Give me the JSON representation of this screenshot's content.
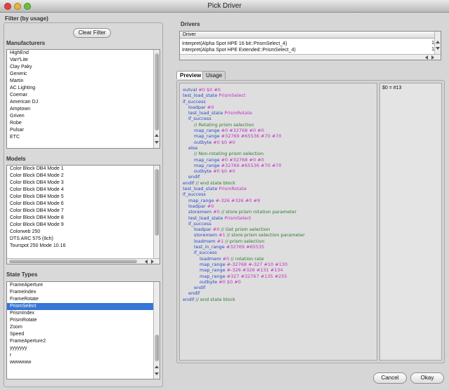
{
  "window": {
    "title": "Pick Driver"
  },
  "filter": {
    "title": "Filter (by usage)",
    "clear_button": "Clear Filter"
  },
  "manufacturers": {
    "label": "Manufacturers",
    "items": [
      "HighEnd",
      "Vari*Lite",
      "Clay Paky",
      "Generic",
      "Martin",
      "AC Lighting",
      "Coemar",
      "American DJ",
      "Amptown",
      "Griven",
      "Robe",
      "Pulsar",
      "ETC"
    ]
  },
  "models": {
    "label": "Models",
    "items": [
      "Color Block DB4 Mode 1",
      "Color Block DB4 Mode 2",
      "Color Block DB4 Mode 3",
      "Color Block DB4 Mode 4",
      "Color Block DB4 Mode 5",
      "Color Block DB4 Mode 6",
      "Color Block DB4 Mode 7",
      "Color Block DB4 Mode 8",
      "Color Block DB4 Mode 9",
      "Colorweb 250",
      "DTS ARC 575 (8ch)",
      "Tourspot 250 Mode 10.16"
    ]
  },
  "state_types": {
    "label": "State Types",
    "selected_index": 3,
    "items": [
      "FrameAperture",
      "FrameIndex",
      "FrameRotate",
      "PrismSelect",
      "PrismIndex",
      "PrismRotate",
      "Zoom",
      "Speed",
      "FrameAperture2",
      "yyyyyyy",
      "r",
      "wwwwww"
    ]
  },
  "drivers": {
    "label": "Drivers",
    "column_header": "Driver",
    "rows": [
      {
        "name": "Interpret(Alpha Spot HPE 16 bit::PrismSelect_4)",
        "flag": "1"
      },
      {
        "name": "Interpret(Alpha Spot HPE Extended::PrismSelect_4)",
        "flag": "1"
      }
    ]
  },
  "tabs": [
    {
      "label": "Preview",
      "active": true
    },
    {
      "label": "Usage",
      "active": false
    }
  ],
  "preview_code": [
    {
      "indent": 0,
      "parts": [
        {
          "t": "outval",
          "c": "kw"
        },
        {
          "t": " #0 $0 #0",
          "c": "arg"
        }
      ]
    },
    {
      "indent": 0,
      "parts": [
        {
          "t": "test_load_state",
          "c": "kw"
        },
        {
          "t": " PrismSelect",
          "c": "arg"
        }
      ]
    },
    {
      "indent": 0,
      "parts": [
        {
          "t": "if_success",
          "c": "kw"
        }
      ]
    },
    {
      "indent": 1,
      "parts": [
        {
          "t": "loadpar",
          "c": "kw"
        },
        {
          "t": " #0",
          "c": "arg"
        }
      ]
    },
    {
      "indent": 1,
      "parts": [
        {
          "t": "test_load_state",
          "c": "kw"
        },
        {
          "t": " PrismRotate",
          "c": "arg"
        }
      ]
    },
    {
      "indent": 1,
      "parts": [
        {
          "t": "if_success",
          "c": "kw"
        }
      ]
    },
    {
      "indent": 2,
      "parts": [
        {
          "t": "// Rotating prism selection",
          "c": "cm"
        }
      ]
    },
    {
      "indent": 2,
      "parts": [
        {
          "t": "map_range",
          "c": "kw"
        },
        {
          "t": " #0 #32768 #0 #0",
          "c": "arg"
        }
      ]
    },
    {
      "indent": 2,
      "parts": [
        {
          "t": "map_range",
          "c": "kw"
        },
        {
          "t": " #32769 #65536 #70 #70",
          "c": "arg"
        }
      ]
    },
    {
      "indent": 2,
      "parts": [
        {
          "t": "outbyte",
          "c": "kw"
        },
        {
          "t": " #0 $0 #0",
          "c": "arg"
        }
      ]
    },
    {
      "indent": 1,
      "parts": [
        {
          "t": "else",
          "c": "kw"
        }
      ]
    },
    {
      "indent": 2,
      "parts": [
        {
          "t": "// Non-rotating prism selection",
          "c": "cm"
        }
      ]
    },
    {
      "indent": 2,
      "parts": [
        {
          "t": "map_range",
          "c": "kw"
        },
        {
          "t": " #0 #32768 #0 #0",
          "c": "arg"
        }
      ]
    },
    {
      "indent": 2,
      "parts": [
        {
          "t": "map_range",
          "c": "kw"
        },
        {
          "t": " #32769 #65536 #70 #70",
          "c": "arg"
        }
      ]
    },
    {
      "indent": 2,
      "parts": [
        {
          "t": "outbyte",
          "c": "kw"
        },
        {
          "t": " #0 $0 #0",
          "c": "arg"
        }
      ]
    },
    {
      "indent": 1,
      "parts": [
        {
          "t": "endif",
          "c": "kw"
        }
      ]
    },
    {
      "indent": 0,
      "parts": [
        {
          "t": "endif",
          "c": "kw"
        },
        {
          "t": " // end state block",
          "c": "cm"
        }
      ]
    },
    {
      "indent": 0,
      "parts": [
        {
          "t": "test_load_state",
          "c": "kw"
        },
        {
          "t": " PrismRotate",
          "c": "arg"
        }
      ]
    },
    {
      "indent": 0,
      "parts": [
        {
          "t": "if_success",
          "c": "kw"
        }
      ]
    },
    {
      "indent": 1,
      "parts": [
        {
          "t": "map_range",
          "c": "kw"
        },
        {
          "t": " #-326 #326 #0 #9",
          "c": "arg"
        }
      ]
    },
    {
      "indent": 1,
      "parts": [
        {
          "t": "loadpar",
          "c": "kw"
        },
        {
          "t": " #0",
          "c": "arg"
        }
      ]
    },
    {
      "indent": 1,
      "parts": [
        {
          "t": "storemem",
          "c": "kw"
        },
        {
          "t": " #0",
          "c": "arg"
        },
        {
          "t": " // store prism rotation parameter",
          "c": "cm"
        }
      ]
    },
    {
      "indent": 1,
      "parts": [
        {
          "t": "test_load_state",
          "c": "kw"
        },
        {
          "t": " PrismSelect",
          "c": "arg"
        }
      ]
    },
    {
      "indent": 1,
      "parts": [
        {
          "t": "if_success",
          "c": "kw"
        }
      ]
    },
    {
      "indent": 2,
      "parts": [
        {
          "t": "loadpar",
          "c": "kw"
        },
        {
          "t": " #0",
          "c": "arg"
        },
        {
          "t": " // Get prism selection",
          "c": "cm"
        }
      ]
    },
    {
      "indent": 2,
      "parts": [
        {
          "t": "storemem",
          "c": "kw"
        },
        {
          "t": " #1",
          "c": "arg"
        },
        {
          "t": " // store prism selection parameter",
          "c": "cm"
        }
      ]
    },
    {
      "indent": 2,
      "parts": [
        {
          "t": "loadmem",
          "c": "kw"
        },
        {
          "t": " #1",
          "c": "arg"
        },
        {
          "t": " // prism selection",
          "c": "cm"
        }
      ]
    },
    {
      "indent": 2,
      "parts": [
        {
          "t": "test_in_range",
          "c": "kw"
        },
        {
          "t": " #32769 #65535",
          "c": "arg"
        }
      ]
    },
    {
      "indent": 2,
      "parts": [
        {
          "t": "if_success",
          "c": "kw"
        }
      ]
    },
    {
      "indent": 3,
      "parts": [
        {
          "t": "loadmem",
          "c": "kw"
        },
        {
          "t": " #0",
          "c": "arg"
        },
        {
          "t": " // rotation rate",
          "c": "cm"
        }
      ]
    },
    {
      "indent": 3,
      "parts": [
        {
          "t": "map_range",
          "c": "kw"
        },
        {
          "t": " #-32768 #-327 #10 #130",
          "c": "arg"
        }
      ]
    },
    {
      "indent": 3,
      "parts": [
        {
          "t": "map_range",
          "c": "kw"
        },
        {
          "t": " #-326 #326 #131 #134",
          "c": "arg"
        }
      ]
    },
    {
      "indent": 3,
      "parts": [
        {
          "t": "map_range",
          "c": "kw"
        },
        {
          "t": " #327 #32767 #135 #255",
          "c": "arg"
        }
      ]
    },
    {
      "indent": 3,
      "parts": [
        {
          "t": "outbyte",
          "c": "kw"
        },
        {
          "t": " #0 $0 #0",
          "c": "arg"
        }
      ]
    },
    {
      "indent": 2,
      "parts": [
        {
          "t": "endif",
          "c": "kw"
        }
      ]
    },
    {
      "indent": 1,
      "parts": [
        {
          "t": "endif",
          "c": "kw"
        }
      ]
    },
    {
      "indent": 0,
      "parts": [
        {
          "t": "endif",
          "c": "kw"
        },
        {
          "t": " // end state block",
          "c": "cm"
        }
      ]
    }
  ],
  "preview_output": "$0 = #13",
  "buttons": {
    "cancel": "Cancel",
    "okay": "Okay"
  },
  "colors": {
    "keyword": "#2a47c8",
    "argument": "#c02ec6",
    "comment": "#2e7a2e",
    "selection": "#3576d6"
  }
}
